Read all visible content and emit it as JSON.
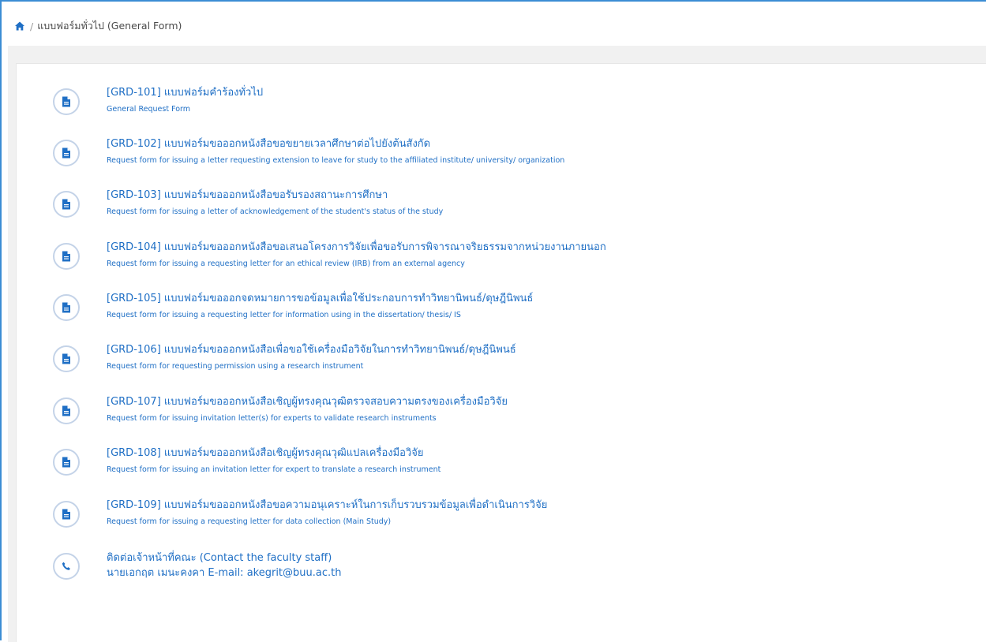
{
  "breadcrumb": {
    "home_icon": "home-icon",
    "separator": "/",
    "current": "แบบฟอร์มทั่วไป (General Form)"
  },
  "forms": [
    {
      "title": "[GRD-101] แบบฟอร์มคำร้องทั่วไป",
      "subtitle": "General Request Form",
      "icon": "document-icon"
    },
    {
      "title": "[GRD-102] แบบฟอร์มขอออกหนังสือขอขยายเวลาศึกษาต่อไปยังต้นสังกัด",
      "subtitle": "Request form for issuing a letter requesting extension to leave for study to the affiliated institute/ university/ organization",
      "icon": "document-icon"
    },
    {
      "title": "[GRD-103] แบบฟอร์มขอออกหนังสือขอรับรองสถานะการศึกษา",
      "subtitle": "Request form for issuing a letter of acknowledgement of the student's status of the study",
      "icon": "document-icon"
    },
    {
      "title": "[GRD-104] แบบฟอร์มขอออกหนังสือขอเสนอโครงการวิจัยเพื่อขอรับการพิจารณาจริยธรรมจากหน่วยงานภายนอก",
      "subtitle": "Request form for issuing a requesting letter for an ethical review (IRB) from an external agency",
      "icon": "document-icon"
    },
    {
      "title": "[GRD-105] แบบฟอร์มขอออกจดหมายการขอข้อมูลเพื่อใช้ประกอบการทำวิทยานิพนธ์/ดุษฎีนิพนธ์",
      "subtitle": "Request form for issuing a requesting letter for information using in the dissertation/ thesis/ IS",
      "icon": "document-icon"
    },
    {
      "title": "[GRD-106] แบบฟอร์มขอออกหนังสือเพื่อขอใช้เครื่องมือวิจัยในการทำวิทยานิพนธ์/ดุษฎีนิพนธ์",
      "subtitle": "Request form for requesting permission using a research instrument",
      "icon": "document-icon"
    },
    {
      "title": "[GRD-107] แบบฟอร์มขอออกหนังสือเชิญผู้ทรงคุณวุฒิตรวจสอบความตรงของเครื่องมือวิจัย",
      "subtitle": "Request form for issuing invitation letter(s) for experts to validate research instruments",
      "icon": "document-icon"
    },
    {
      "title": "[GRD-108] แบบฟอร์มขอออกหนังสือเชิญผู้ทรงคุณวุฒิแปลเครื่องมือวิจัย",
      "subtitle": "Request form for issuing an invitation letter for expert to translate a research instrument",
      "icon": "document-icon"
    },
    {
      "title": "[GRD-109] แบบฟอร์มขอออกหนังสือขอความอนุเคราะห์ในการเก็บรวบรวมข้อมูลเพื่อดำเนินการวิจัย",
      "subtitle": "Request form for issuing a requesting letter for data collection (Main Study)",
      "icon": "document-icon"
    }
  ],
  "contact": {
    "icon": "phone-icon",
    "title": "ติดต่อเจ้าหน้าที่คณะ (Contact the faculty staff)",
    "detail": "นายเอกฤต เมนะคงคา E-mail: akegrit@buu.ac.th"
  },
  "colors": {
    "link": "#1f6fc5",
    "icon": "#1f6fc5",
    "icon_border": "#c4d3e8",
    "top_border": "#3b8dd4",
    "panel_bg": "#f1f1f1"
  }
}
